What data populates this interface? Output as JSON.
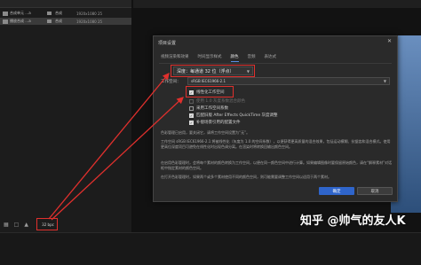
{
  "project_panel": {
    "rows": [
      {
        "name": "合成单元 …aex",
        "type": "合成",
        "size": "1920x1080",
        "fps": "25",
        "selected": false
      },
      {
        "name": "播放合成 …aex",
        "type": "合成",
        "size": "1920x1080",
        "fps": "25",
        "selected": true
      }
    ],
    "bpc": "32 bpc"
  },
  "dialog": {
    "title": "项目设置",
    "close": "✕",
    "tabs": [
      "视频渲染和效果",
      "时间显示样式",
      "颜色",
      "音频",
      "表达式"
    ],
    "active_tab": 2,
    "depth_label": "深度：每通道 32 位（浮点）",
    "workspace_label": "工作空间：",
    "workspace_value": "sRGB IEC61966-2.1",
    "checks": [
      {
        "label": "线性化工作空间",
        "on": true,
        "dim": false
      },
      {
        "label": "使用 1.0 灰度系数混合颜色",
        "on": false,
        "dim": true
      },
      {
        "label": "采用工作空间系数",
        "on": false,
        "dim": false
      },
      {
        "label": "匹配旧版 After Effects QuickTime 灰度调整",
        "on": true,
        "dim": false
      },
      {
        "label": "补偿场景引用的配置文件",
        "on": true,
        "dim": false
      }
    ],
    "para1": "色彩管理已启用，要关闭它，请将工作空间设置为“无”。",
    "para2": "工作空间 sRGB IEC61966-2.1 将被线性化（灰度为 1.0 的空间系数），以便获得更高质量的混合效果，包括运动模糊、抗锯齿和混合模式。使用更高位深度项目可避免在线性化时出现色调分离。在渲染时将转换回输出颜色空间。",
    "para3": "在启用色彩管理时，会将每个素材的颜色转换为工作空间，以便在同一颜色空间中进行计算。如果编辑图像时要保留原始颜色，请在“解释素材”对话框中指定素材的颜色空间。",
    "para4": "在打开色彩管理时，如果两个或多个素材使用不同的颜色空间，则可能需要调整工作空间以适用于两个素材。",
    "ok_label": "确定",
    "cancel_label": "取消"
  },
  "watermark": "知乎 @帅气的友人K",
  "colors": {
    "accent": "#2f65cb",
    "highlight": "#e0302d"
  }
}
